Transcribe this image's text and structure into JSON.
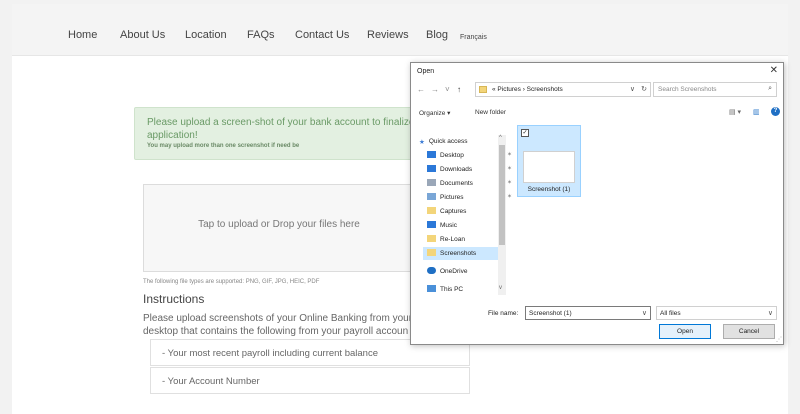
{
  "nav": {
    "items": [
      "Home",
      "About Us",
      "Location",
      "FAQs",
      "Contact Us",
      "Reviews",
      "Blog"
    ],
    "language": "Français"
  },
  "notice": {
    "line1": "Please upload a screen-shot of your bank account to finalize",
    "line2": "application!",
    "sub": "You may upload more than one screenshot if need be"
  },
  "dropzone": {
    "text": "Tap to upload or Drop your files here"
  },
  "file_types": "The following file types are supported: PNG, GIF, JPG, HEIC, PDF",
  "instructions": {
    "title": "Instructions",
    "line1": "Please upload screenshots of your Online Banking from your",
    "line2": "desktop that contains the following from your payroll accoun",
    "requirements": [
      "- Your most recent payroll including current balance",
      "- Your Account Number"
    ]
  },
  "dialog": {
    "title": "Open",
    "close": "✕",
    "nav_buttons": [
      "←",
      "→",
      "˅",
      "↑"
    ],
    "address": "« Pictures › Screenshots",
    "address_dropdown": "∨",
    "refresh_icon": "↻",
    "search_placeholder": "Search Screenshots",
    "search_icon": "⌕",
    "toolbar": {
      "organize": "Organize ▾",
      "new_folder": "New folder"
    },
    "sidebar": [
      {
        "label": "Quick access",
        "icon": "star-icon",
        "color": "#3a7bd5"
      },
      {
        "label": "Desktop",
        "icon": "desktop-icon",
        "color": "#2b78d8",
        "pin": "✶"
      },
      {
        "label": "Downloads",
        "icon": "download-icon",
        "color": "#2b78d8",
        "pin": "✶"
      },
      {
        "label": "Documents",
        "icon": "documents-icon",
        "color": "#9aa7b8",
        "pin": "✶"
      },
      {
        "label": "Pictures",
        "icon": "pictures-icon",
        "color": "#7aa6d6",
        "pin": "✶"
      },
      {
        "label": "Captures",
        "icon": "folder-icon",
        "color": "#f3d57a"
      },
      {
        "label": "Music",
        "icon": "music-icon",
        "color": "#2b78d8"
      },
      {
        "label": "Re-Loan",
        "icon": "folder-icon",
        "color": "#f3d57a"
      },
      {
        "label": "Screenshots",
        "icon": "folder-icon",
        "color": "#f3d57a",
        "selected": true
      },
      {
        "label": "OneDrive",
        "icon": "cloud-icon",
        "color": "#1f6fc4"
      },
      {
        "label": "This PC",
        "icon": "computer-icon",
        "color": "#4a90d9"
      }
    ],
    "file": {
      "label": "Screenshot (1)",
      "checked": "✓"
    },
    "file_name_label": "File name:",
    "file_name_value": "Screenshot (1)",
    "file_type": "All files",
    "open_button": "Open",
    "cancel_button": "Cancel"
  }
}
